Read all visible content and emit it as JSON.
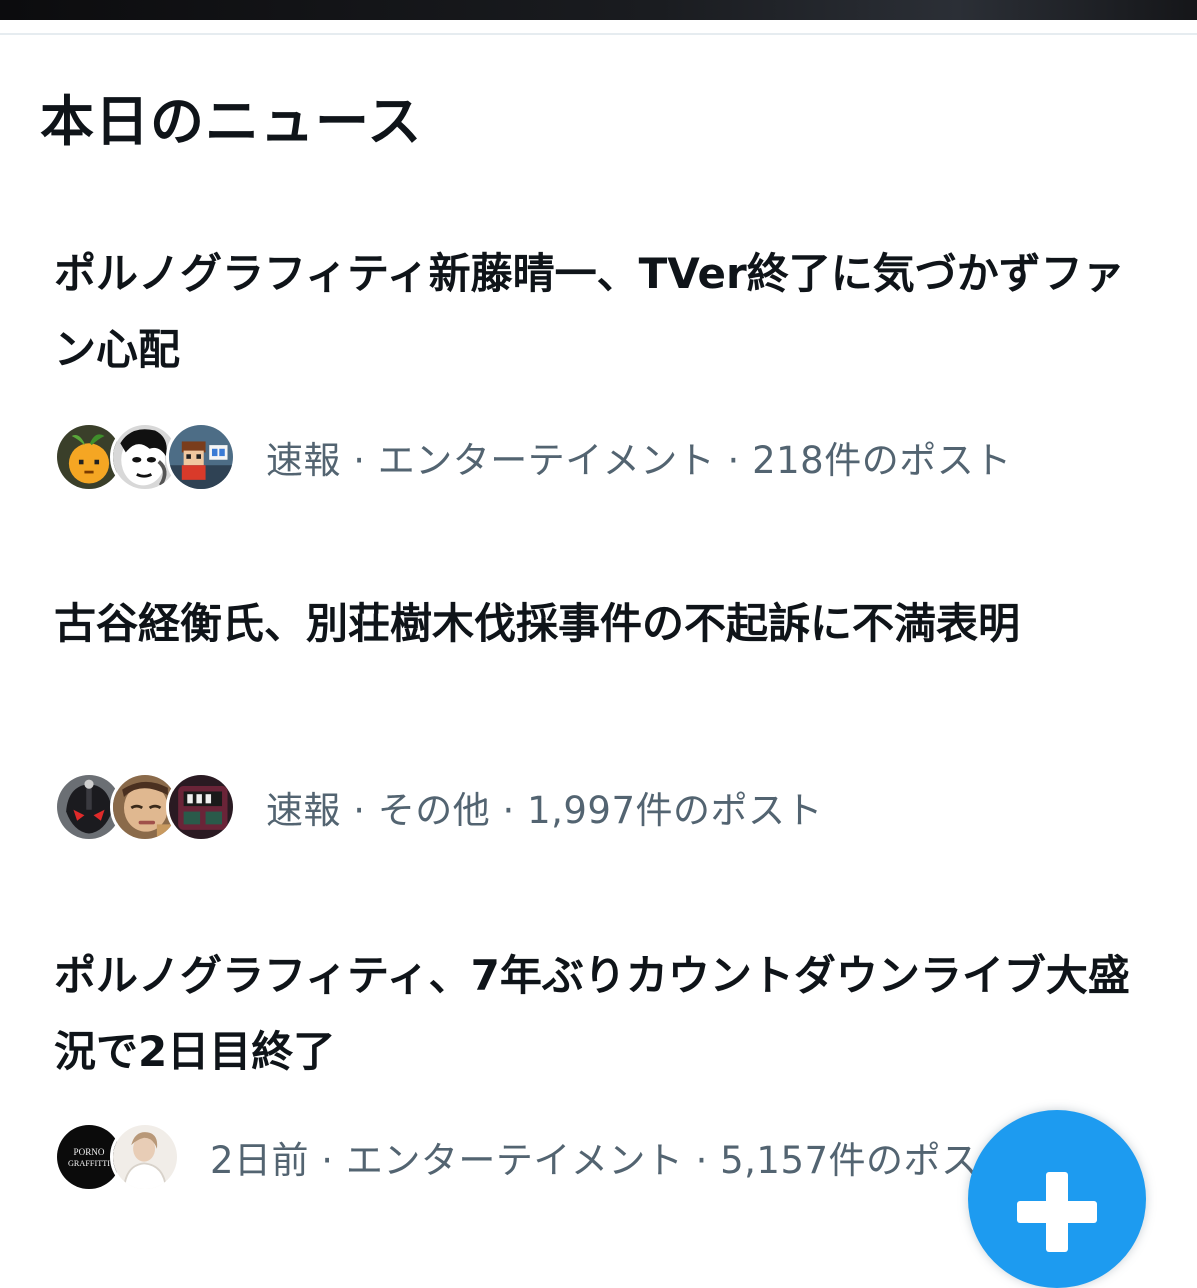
{
  "section": {
    "title": "本日のニュース"
  },
  "news": [
    {
      "headline": "ポルノグラフィティ新藤晴一、TVer終了に気づかずファン心配",
      "meta": "速報 · エンターテイメント · 218件のポスト",
      "avatars": [
        "orange-avatar",
        "portrait-avatar",
        "pixel-art-avatar"
      ]
    },
    {
      "headline": "古谷経衡氏、別荘樹木伐採事件の不起訴に不満表明",
      "meta": "速報 · その他 · 1,997件のポスト",
      "avatars": [
        "helmet-avatar",
        "face-avatar",
        "train-avatar"
      ]
    },
    {
      "headline": "ポルノグラフィティ、7年ぶりカウントダウンライブ大盛況で2日目終了",
      "meta": "2日前 · エンターテイメント · 5,157件のポスト",
      "avatars": [
        "porno-graffitti-logo-avatar",
        "person-avatar"
      ]
    }
  ],
  "logo_text": "PornoGraffitti",
  "compose_button": {
    "icon": "plus-icon",
    "color": "#1d9bf0"
  },
  "colors": {
    "text_primary": "#0f1419",
    "text_secondary": "#536471",
    "accent": "#1d9bf0"
  }
}
